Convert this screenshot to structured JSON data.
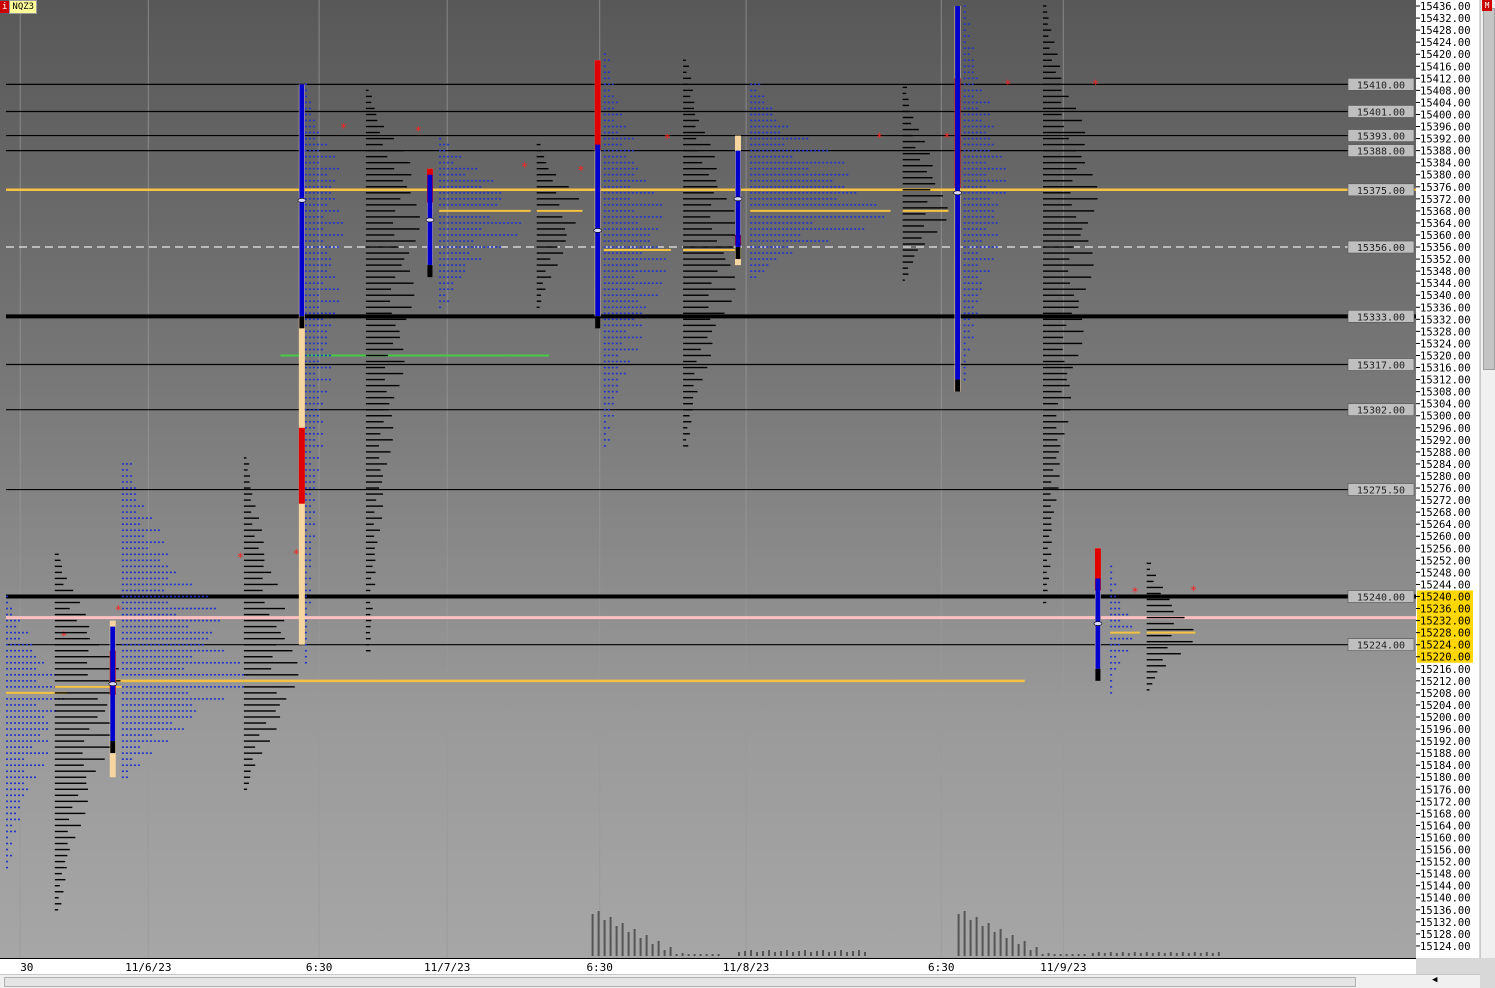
{
  "header": {
    "symbol": "NQZ3",
    "symbol_badge": "i",
    "corner_badge": "M"
  },
  "colors": {
    "ticks": "#2233cc",
    "profile": "#000000",
    "profile_blue": "#4a4a7a",
    "poc": "#f5c242",
    "value_area_high": "#e00000",
    "initial_balance": "#0000cc",
    "range_bar": "#f5d6a0",
    "level_line": "#000000",
    "reference_line": "#ffc0c0",
    "green_line": "#44cc44",
    "axis_highlight": "#ffd700"
  },
  "chart_data": {
    "type": "market-profile",
    "ylim": [
      15120,
      15438
    ],
    "y_tick_step": 4,
    "y_tick_start": 15124,
    "y_tick_end": 15436,
    "x_labels": [
      {
        "label": "30",
        "slot": 0.2
      },
      {
        "label": "11/6/23",
        "slot": 2.3
      },
      {
        "label": "6:30",
        "slot": 5.1
      },
      {
        "label": "11/7/23",
        "slot": 7.2
      },
      {
        "label": "6:30",
        "slot": 9.7
      },
      {
        "label": "11/8/23",
        "slot": 12.1
      },
      {
        "label": "6:30",
        "slot": 15.3
      },
      {
        "label": "11/9/23",
        "slot": 17.3
      }
    ],
    "levels": [
      {
        "price": 15410.0,
        "label": "15410.00",
        "style": "solid"
      },
      {
        "price": 15401.0,
        "label": "15401.00",
        "style": "solid"
      },
      {
        "price": 15393.0,
        "label": "15393.00",
        "style": "solid"
      },
      {
        "price": 15388.0,
        "label": "15388.00",
        "style": "solid"
      },
      {
        "price": 15375.0,
        "label": "15375.00",
        "style": "poc"
      },
      {
        "price": 15356.0,
        "label": "15356.00",
        "style": "dashed"
      },
      {
        "price": 15333.0,
        "label": "15333.00",
        "style": "thick"
      },
      {
        "price": 15317.0,
        "label": "15317.00",
        "style": "solid"
      },
      {
        "price": 15302.0,
        "label": "15302.00",
        "style": "solid"
      },
      {
        "price": 15275.5,
        "label": "15275.50",
        "style": "solid"
      },
      {
        "price": 15240.0,
        "label": "15240.00",
        "style": "thick"
      },
      {
        "price": 15224.0,
        "label": "15224.00",
        "style": "solid"
      }
    ],
    "axis_highlights": [
      "15240.00",
      "15236.00",
      "15232.00",
      "15228.00",
      "15224.00",
      "15220.00"
    ],
    "profiles": [
      {
        "slot": 0.0,
        "low": 15150,
        "high": 15240,
        "poc": 15208,
        "kind": "ticks",
        "width": 2
      },
      {
        "slot": 0.8,
        "low": 15136,
        "high": 15254,
        "poc": 15210,
        "kind": "profile",
        "width": 2.2
      },
      {
        "slot": 1.9,
        "low": 15180,
        "high": 15284,
        "poc": 15212,
        "kind": "ticks",
        "width": 4.2
      },
      {
        "slot": 3.9,
        "low": 15176,
        "high": 15286,
        "poc": 15212,
        "kind": "profile",
        "width": 1.8
      },
      {
        "slot": 4.9,
        "low": 15218,
        "high": 15410,
        "poc": 15375,
        "kind": "ticks",
        "width": 1.3
      },
      {
        "slot": 5.9,
        "low": 15222,
        "high": 15408,
        "poc": 15375,
        "kind": "profile",
        "width": 1.8
      },
      {
        "slot": 7.1,
        "low": 15336,
        "high": 15392,
        "poc": 15368,
        "kind": "ticks",
        "width": 3
      },
      {
        "slot": 8.7,
        "low": 15336,
        "high": 15390,
        "poc": 15368,
        "kind": "profile",
        "width": 1.5
      },
      {
        "slot": 9.8,
        "low": 15290,
        "high": 15420,
        "poc": 15355,
        "kind": "ticks",
        "width": 2.2
      },
      {
        "slot": 11.1,
        "low": 15290,
        "high": 15418,
        "poc": 15355,
        "kind": "profile",
        "width": 1.9
      },
      {
        "slot": 12.2,
        "low": 15346,
        "high": 15410,
        "poc": 15368,
        "kind": "ticks",
        "width": 4.6
      },
      {
        "slot": 14.7,
        "low": 15345,
        "high": 15410,
        "poc": 15368,
        "kind": "profile",
        "width": 1.5
      },
      {
        "slot": 15.7,
        "low": 15312,
        "high": 15436,
        "poc": 15375,
        "kind": "ticks",
        "width": 1.5
      },
      {
        "slot": 17.0,
        "low": 15238,
        "high": 15436,
        "poc": 15375,
        "kind": "profile",
        "width": 1.8
      },
      {
        "slot": 18.1,
        "low": 15208,
        "high": 15250,
        "poc": 15228,
        "kind": "ticks",
        "width": 0.8
      },
      {
        "slot": 18.7,
        "low": 15209,
        "high": 15251,
        "poc": 15228,
        "kind": "profile",
        "width": 1.6
      }
    ],
    "range_bars": [
      {
        "slot": 1.75,
        "low": 15180,
        "high": 15232,
        "ib_low": 15192,
        "ib_high": 15230,
        "red_high": 15222
      },
      {
        "slot": 4.85,
        "low": 15224,
        "high": 15410,
        "ib_low": 15333,
        "ib_high": 15410,
        "red_high": 15296
      },
      {
        "slot": 6.95,
        "low": 15350,
        "high": 15382,
        "ib_low": 15350,
        "ib_high": 15380,
        "red_high": 15382
      },
      {
        "slot": 9.7,
        "low": 15333,
        "high": 15418,
        "ib_low": 15333,
        "ib_high": 15390,
        "red_high": 15418
      },
      {
        "slot": 12.0,
        "low": 15350,
        "high": 15393,
        "ib_low": 15356,
        "ib_high": 15388,
        "red_high": 15360
      },
      {
        "slot": 15.6,
        "low": 15308,
        "high": 15436,
        "ib_low": 15312,
        "ib_high": 15436,
        "red_high": 15412
      },
      {
        "slot": 17.9,
        "low": 15216,
        "high": 15256,
        "ib_low": 15216,
        "ib_high": 15246,
        "red_high": 15256
      }
    ],
    "volume_slots": [
      9.6,
      12.0,
      15.6,
      17.8
    ]
  }
}
